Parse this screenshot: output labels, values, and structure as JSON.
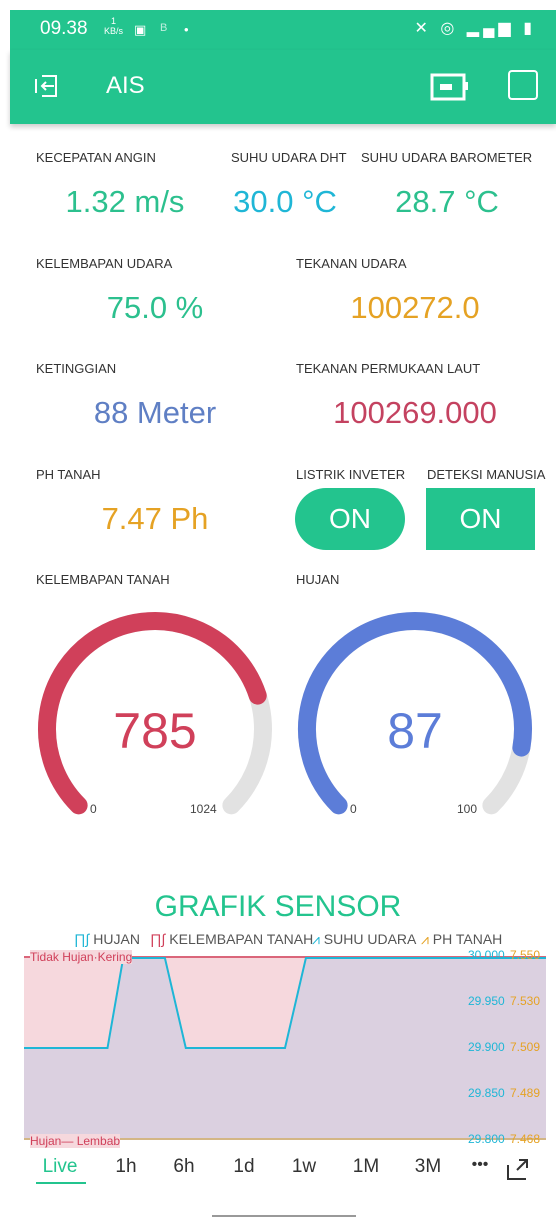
{
  "status_bar": {
    "time": "09.38",
    "speed_value": "1",
    "speed_unit": "KB/s",
    "extra": "B"
  },
  "app_bar": {
    "title": "AIS"
  },
  "widgets": {
    "wind_speed": {
      "label": "KECEPATAN ANGIN",
      "value": "1.32 m/s"
    },
    "temp_dht": {
      "label": "SUHU UDARA DHT",
      "value": "30.0 °C"
    },
    "temp_baro": {
      "label": "SUHU UDARA BAROMETER",
      "value": "28.7 °C"
    },
    "humidity": {
      "label": "KELEMBAPAN UDARA",
      "value": "75.0 %"
    },
    "pressure": {
      "label": "TEKANAN UDARA",
      "value": "100272.0"
    },
    "altitude": {
      "label": "KETINGGIAN",
      "value": "88 Meter"
    },
    "sea_pressure": {
      "label": "TEKANAN PERMUKAAN LAUT",
      "value": "100269.000"
    },
    "ph": {
      "label": "PH TANAH",
      "value": "7.47 Ph"
    },
    "inverter": {
      "label": "LISTRIK INVETER",
      "state": "ON"
    },
    "human": {
      "label": "DETEKSI MANUSIA",
      "state": "ON"
    }
  },
  "gauges": {
    "soil": {
      "label": "KELEMBAPAN TANAH",
      "value": 785,
      "display": "785",
      "min": "0",
      "max": "1024",
      "max_num": 1024,
      "color": "#d0405a"
    },
    "rain": {
      "label": "HUJAN",
      "value": 87,
      "display": "87",
      "min": "0",
      "max": "100",
      "max_num": 100,
      "color": "#5c7dd8"
    }
  },
  "colors": {
    "accent": "#23c48e",
    "wind": "#2cc08e",
    "temp": "#1fb6d6",
    "pressure": "#e5a224",
    "altitude": "#5f7fc4",
    "sea": "#c44260",
    "ph": "#e5a224"
  },
  "chart": {
    "title": "GRAFIK SENSOR",
    "legend": [
      "HUJAN",
      "KELEMBAPAN TANAH",
      "SUHU UDARA",
      "PH TANAH"
    ],
    "left_top": {
      "a": "Tidak Hujan",
      "b": "Kering"
    },
    "left_bottom": {
      "a": "Hujan",
      "b": "Lembab"
    },
    "right_temp": [
      "30.000",
      "29.950",
      "29.900",
      "29.850",
      "29.800"
    ],
    "right_ph": [
      "7.550",
      "7.530",
      "7.509",
      "7.489",
      "7.468"
    ],
    "tabs": [
      "Live",
      "1h",
      "6h",
      "1d",
      "1w",
      "1M",
      "3M",
      "•••"
    ]
  },
  "chart_data": {
    "type": "line",
    "title": "GRAFIK SENSOR",
    "series": [
      {
        "name": "SUHU UDARA",
        "points": [
          [
            0,
            29.9
          ],
          [
            0.16,
            29.9
          ],
          [
            0.19,
            30.0
          ],
          [
            0.27,
            30.0
          ],
          [
            0.31,
            29.9
          ],
          [
            0.5,
            29.9
          ],
          [
            0.54,
            30.0
          ],
          [
            1,
            30.0
          ]
        ]
      },
      {
        "name": "HUJAN"
      },
      {
        "name": "KELEMBAPAN TANAH"
      },
      {
        "name": "PH TANAH"
      }
    ],
    "ylim_temp": [
      29.8,
      30.0
    ],
    "ylim_ph": [
      7.468,
      7.55
    ],
    "grid": false,
    "legend": "top"
  }
}
